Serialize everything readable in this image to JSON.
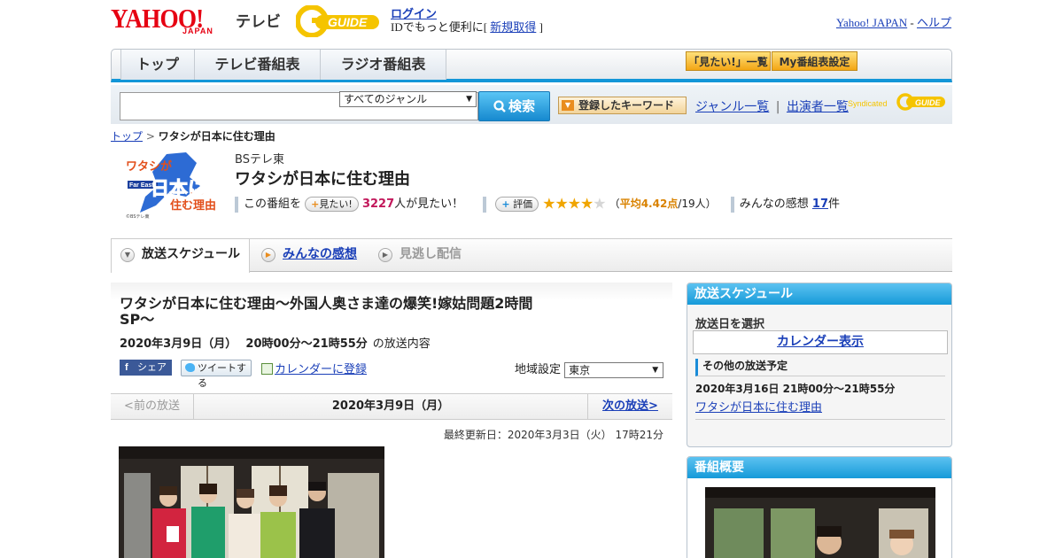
{
  "header": {
    "yahoo_logo": "YAHOO!",
    "japan_sub": "JAPAN",
    "tv_label": "テレビ",
    "gguide_logo": "G-GUIDE",
    "login": "ログイン",
    "login_sub_prefix": "IDでもっと便利に[ ",
    "signup": "新規取得",
    "login_sub_suffix": " ]",
    "yahoo_japan_link": "Yahoo! JAPAN",
    "separator": " - ",
    "help_link": "ヘルプ"
  },
  "nav": {
    "tabs": [
      "トップ",
      "テレビ番組表",
      "ラジオ番組表"
    ],
    "want_list": "「見たい!」一覧",
    "my_schedule": "My番組表設定"
  },
  "search": {
    "genre_selected": "すべてのジャンル",
    "search_button": "検索",
    "keyword_button": "登録したキーワード",
    "genre_list": "ジャンル一覧",
    "divider": "|",
    "performer_list": "出演者一覧",
    "syndicated": "Syndicated"
  },
  "breadcrumb": {
    "top": "トップ",
    "sep": " > ",
    "current": "ワタシが日本に住む理由"
  },
  "program": {
    "logo_text": "ワタシが日本に住む理由",
    "logo_far_east": "Far East",
    "logo_copyright": "©BSテレ東",
    "channel": "BSテレ東",
    "title": "ワタシが日本に住む理由",
    "this_program": "この番組を",
    "want_button": "見たい!",
    "want_count": "3227",
    "want_suffix": "人が見たい！",
    "rate_button": "評価",
    "rating": 4,
    "stars_max": 5,
    "avg_prefix": "（",
    "avg_label": "平均4.42点",
    "avg_suffix": "/19人）",
    "comments_label": "みんなの感想",
    "comments_count": "17",
    "comments_suffix": "件"
  },
  "subtabs": [
    "放送スケジュール",
    "みんなの感想",
    "見逃し配信"
  ],
  "episode": {
    "title": "ワタシが日本に住む理由～外国人奥さま達の爆笑!嫁姑問題2時間SP～",
    "date": "2020年3月9日（月）",
    "time": "20時00分～21時55分",
    "date_suffix": "の放送内容",
    "share_fb": "シェア",
    "share_tw": "ツイートする",
    "calendar_add": "カレンダーに登録",
    "region_label": "地域設定",
    "region_value": "東京"
  },
  "pager": {
    "prev": "<前の放送",
    "current": "2020年3月9日（月）",
    "next": "次の放送>"
  },
  "updated": "最終更新日：2020年3月3日（火） 17時21分",
  "sidebar": {
    "schedule_head": "放送スケジュール",
    "select_date": "放送日を選択",
    "calendar_btn": "カレンダー表示",
    "other_head": "その他の放送予定",
    "other_date": "2020年3月16日 21時00分～21時55分",
    "other_link": "ワタシが日本に住む理由",
    "overview_head": "番組概要"
  },
  "colors": {
    "accent_blue": "#1296d8",
    "yahoo_red": "#e60012",
    "gguide_yellow": "#f5c400",
    "count_magenta": "#c2185b",
    "star_gold": "#f0a500"
  }
}
